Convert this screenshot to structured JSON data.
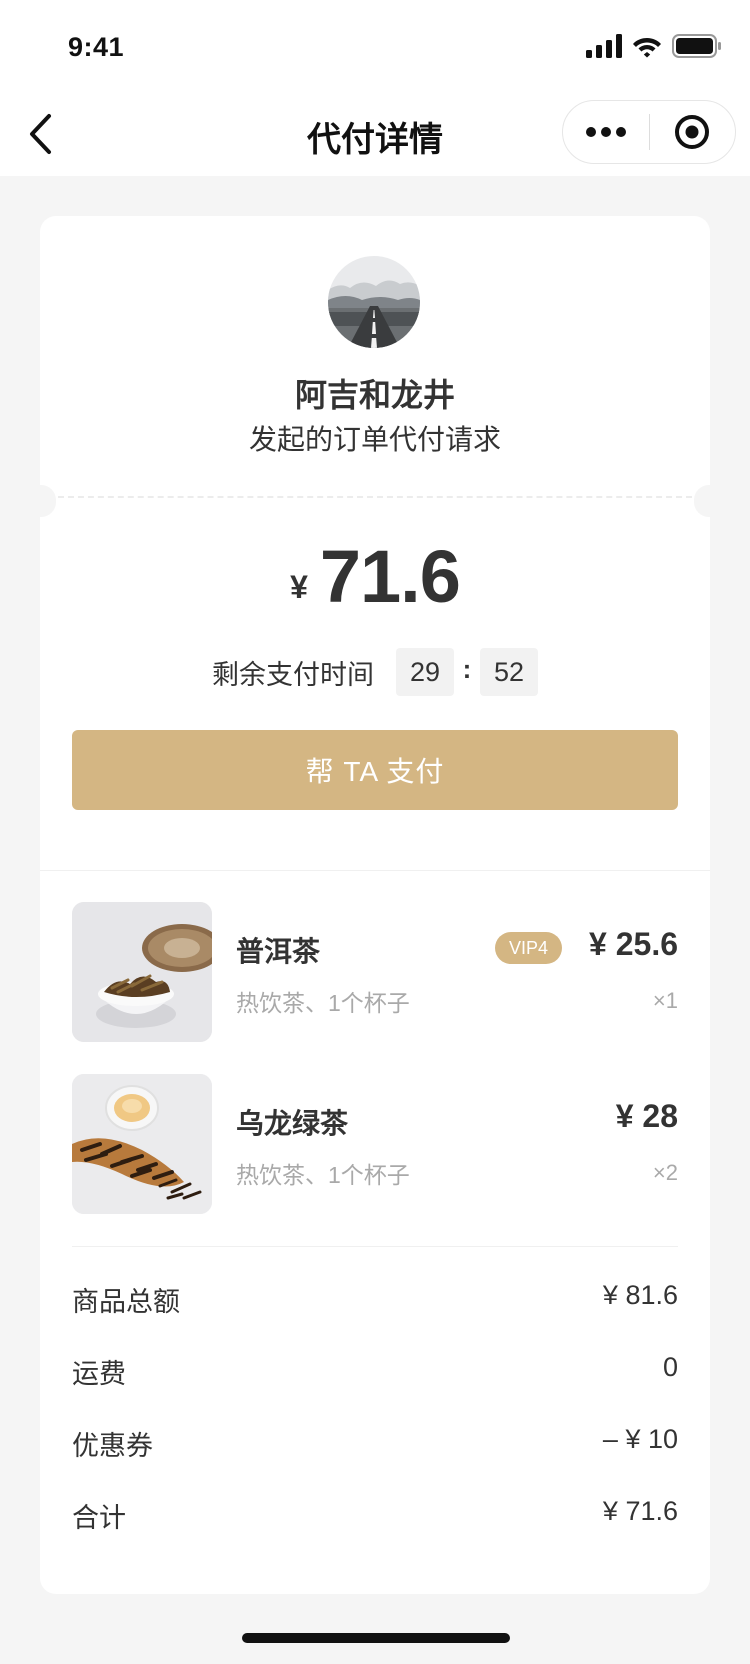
{
  "status_bar": {
    "time": "9:41"
  },
  "nav": {
    "title": "代付详情"
  },
  "requester": {
    "name": "阿吉和龙井",
    "subtitle": "发起的订单代付请求"
  },
  "amount": {
    "currency": "¥",
    "value": "71.6"
  },
  "timer": {
    "label": "剩余支付时间",
    "minutes": "29",
    "seconds": "52",
    "colon": ":"
  },
  "pay_button": {
    "label": "帮 TA 支付"
  },
  "items": [
    {
      "name": "普洱茶",
      "desc": "热饮茶、1个杯子",
      "badge": "VIP4",
      "price": "¥ 25.6",
      "qty": "×1"
    },
    {
      "name": "乌龙绿茶",
      "desc": "热饮茶、1个杯子",
      "price": "¥ 28",
      "qty": "×2"
    }
  ],
  "summary": [
    {
      "label": "商品总额",
      "value": "¥ 81.6"
    },
    {
      "label": "运费",
      "value": "0"
    },
    {
      "label": "优惠券",
      "value": "–  ¥ 10"
    },
    {
      "label": "合计",
      "value": "¥ 71.6"
    }
  ],
  "colors": {
    "accent": "#d4b683",
    "background": "#f5f5f5",
    "text": "#333333",
    "muted": "#a9a9a9"
  },
  "icons": [
    "signal-icon",
    "wifi-icon",
    "battery-icon",
    "back-arrow-icon",
    "more-dots-icon",
    "target-icon"
  ]
}
